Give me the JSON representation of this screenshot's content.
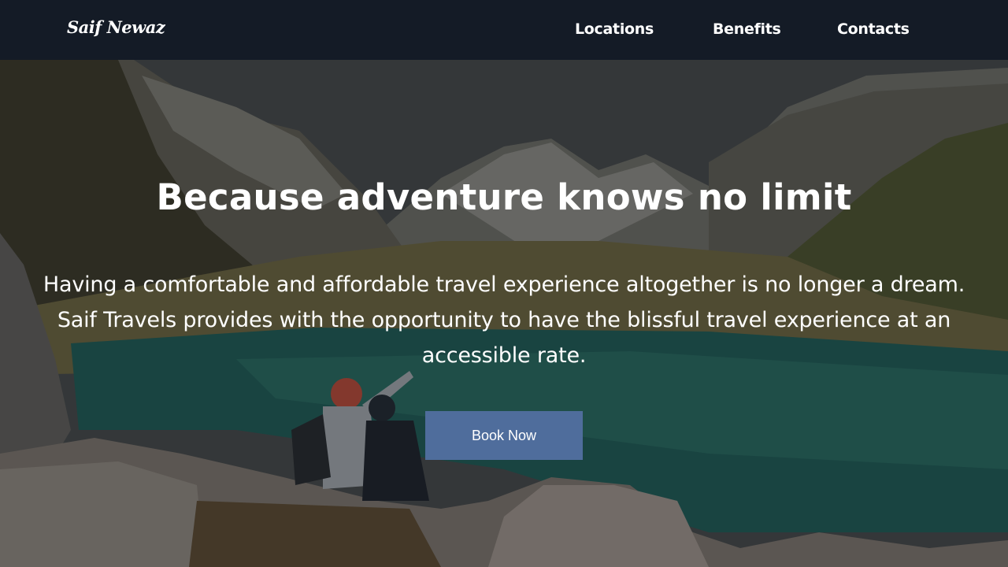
{
  "navbar": {
    "brand": "Saif Newaz",
    "links": [
      "Locations",
      "Benefits",
      "Contacts"
    ]
  },
  "hero": {
    "headline": "Because adventure knows no limit",
    "tagline": "Having a comfortable and affordable travel experience altogether is no longer a dream. Saif Travels provides with the opportunity to have the blissful travel experience at an accessible rate.",
    "cta_label": "Book Now",
    "image_subject": "mountain-lake-couple-photo"
  },
  "colors": {
    "navbar_bg": "#141b26",
    "button_bg": "#4f6d9c",
    "text": "#ffffff"
  }
}
